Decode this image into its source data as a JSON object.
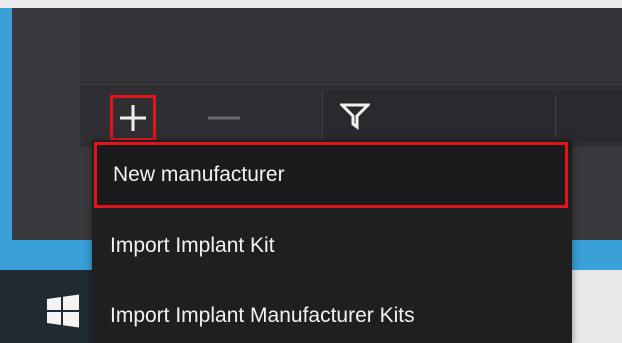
{
  "toolbar": {
    "add_icon": "plus-icon",
    "remove_icon": "minus-icon",
    "filter_icon": "filter-icon"
  },
  "menu": {
    "items": [
      {
        "label": "New manufacturer",
        "highlighted": true
      },
      {
        "label": "Import Implant Kit",
        "highlighted": false
      },
      {
        "label": "Import Implant Manufacturer Kits",
        "highlighted": false
      }
    ]
  },
  "taskbar": {
    "start_icon": "windows-logo-icon"
  },
  "colors": {
    "highlight_border": "#e0141a",
    "desktop_blue": "#3aa0d8",
    "menu_background": "#1f1f22",
    "toolbar_background": "#2f2f33",
    "taskbar_background": "#1f2a33"
  }
}
